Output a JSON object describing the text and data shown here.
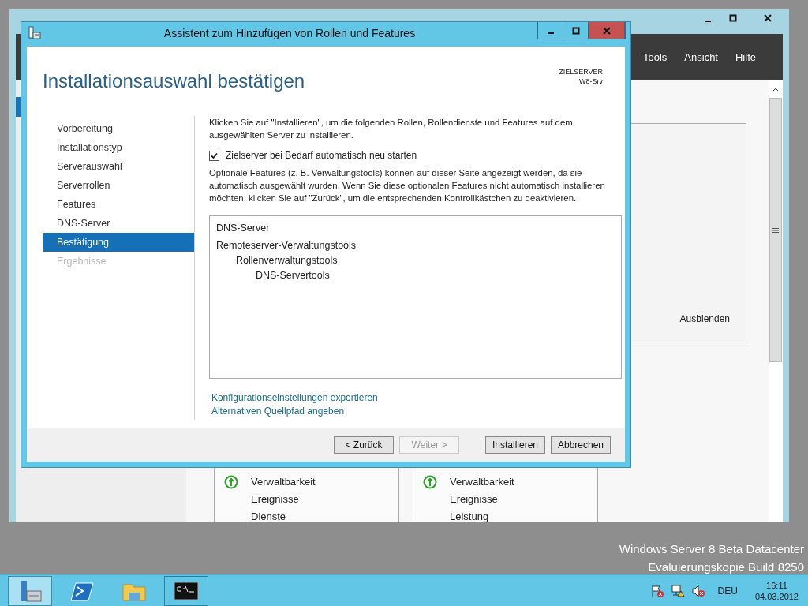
{
  "server_manager": {
    "menu": [
      "Tools",
      "Ansicht",
      "Hilfe"
    ],
    "hide_link": "Ausblenden",
    "tiles": [
      {
        "items": [
          "Verwaltbarkeit",
          "Ereignisse",
          "Dienste"
        ]
      },
      {
        "items": [
          "Verwaltbarkeit",
          "Ereignisse",
          "Leistung"
        ]
      }
    ]
  },
  "dialog": {
    "title": "Assistent zum Hinzufügen von Rollen und Features",
    "heading": "Installationsauswahl bestätigen",
    "target_label": "ZIELSERVER",
    "target_server": "W8-Srv",
    "steps": [
      {
        "label": "Vorbereitung",
        "selected": false,
        "disabled": false
      },
      {
        "label": "Installationstyp",
        "selected": false,
        "disabled": false
      },
      {
        "label": "Serverauswahl",
        "selected": false,
        "disabled": false
      },
      {
        "label": "Serverrollen",
        "selected": false,
        "disabled": false
      },
      {
        "label": "Features",
        "selected": false,
        "disabled": false
      },
      {
        "label": "DNS-Server",
        "selected": false,
        "disabled": false
      },
      {
        "label": "Bestätigung",
        "selected": true,
        "disabled": false
      },
      {
        "label": "Ergebnisse",
        "selected": false,
        "disabled": true
      }
    ],
    "intro": "Klicken Sie auf \"Installieren\", um die folgenden Rollen, Rollendienste und Features auf dem ausgewählten Server zu installieren.",
    "restart": {
      "label": "Zielserver bei Bedarf automatisch neu starten",
      "checked": true
    },
    "note": "Optionale Features (z. B. Verwaltungstools) können auf dieser Seite angezeigt werden, da sie automatisch ausgewählt wurden. Wenn Sie diese optionalen Features nicht automatisch installieren möchten, klicken Sie auf \"Zurück\", um die entsprechenden Kontrollkästchen zu deaktivieren.",
    "features": [
      {
        "label": "DNS-Server"
      },
      {
        "label": "Remoteserver-Verwaltungstools",
        "children": [
          {
            "label": "Rollenverwaltungstools",
            "children": [
              {
                "label": "DNS-Servertools"
              }
            ]
          }
        ]
      }
    ],
    "links": [
      "Konfigurationseinstellungen exportieren",
      "Alternativen Quellpfad angeben"
    ],
    "buttons": [
      {
        "label": "< Zurück",
        "disabled": false
      },
      {
        "label": "Weiter >",
        "disabled": true
      },
      {
        "label": "Installieren",
        "disabled": false
      },
      {
        "label": "Abbrechen",
        "disabled": false
      }
    ]
  },
  "desktop_info": [
    "Windows Server 8 Beta Datacenter",
    "Evaluierungskopie Build 8250"
  ],
  "taskbar": {
    "apps": [
      {
        "kind": "server-manager",
        "selected": true
      },
      {
        "kind": "powershell",
        "selected": false
      },
      {
        "kind": "explorer",
        "selected": false
      },
      {
        "kind": "console",
        "selected": false
      }
    ],
    "language": "DEU",
    "time": "16:11",
    "date": "04.03.2012"
  }
}
